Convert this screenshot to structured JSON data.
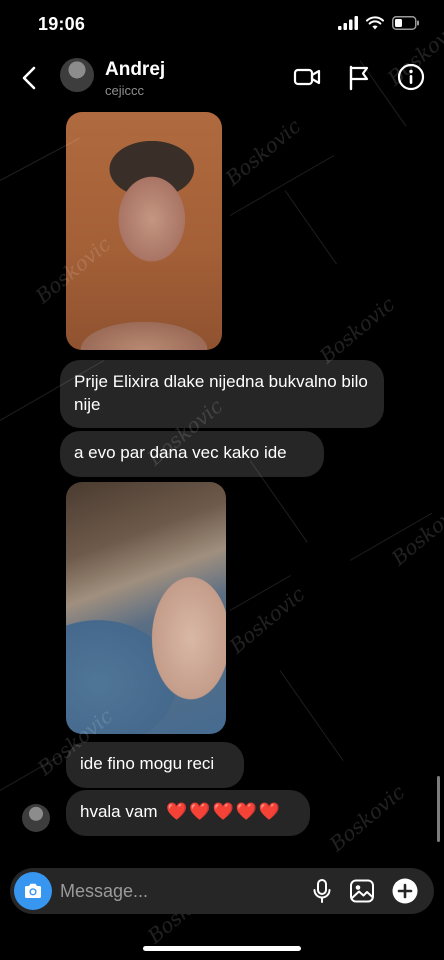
{
  "status_bar": {
    "time": "19:06"
  },
  "header": {
    "name": "Andrej",
    "username": "cejiccc"
  },
  "messages": [
    {
      "type": "image",
      "description_icon": "photo"
    },
    {
      "type": "text",
      "text": "Prije Elixira dlake nijedna bukvalno bilo nije"
    },
    {
      "type": "text",
      "text": "a evo par dana vec kako ide"
    },
    {
      "type": "image",
      "description_icon": "photo"
    },
    {
      "type": "text",
      "text": "ide fino mogu reci"
    },
    {
      "type": "text",
      "text": "hvala vam",
      "emoji": "❤️❤️❤️❤️❤️"
    }
  ],
  "composer": {
    "placeholder": "Message..."
  },
  "watermark": {
    "text": "Boskovic"
  },
  "colors": {
    "background": "#000000",
    "bubble": "#262626",
    "accent": "#3797f0",
    "heart": "#e0242e"
  }
}
